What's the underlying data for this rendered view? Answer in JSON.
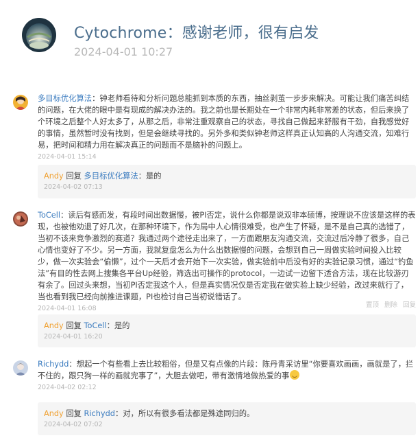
{
  "header": {
    "title": "Cytochrome：感谢老师，很有启发",
    "date": "2024-04-01 10:27"
  },
  "comments": [
    {
      "name": "多目标优化算法",
      "text": "钟老师看待和分析问题总能抓到本质的东西，抽丝剥茧一步步来解决。可能让我们痛苦纠结的问题，在大佬的眼中是有现成的解决办法的。我之前也是长期处在一个非常内耗非常差的状态，但后来换了个环境之后整个人好太多了，从那之后，非常注重观察自己的状态，寻找自己做起来舒服有干劲，自我感觉好的事情，虽然暂时没有找到，但是会继续寻找的。另外多和类似钟老师这样真正认知高的人沟通交流，知难行易，把时间和精力用在解决真正的问题而不是脑补的问题上。",
      "time": "2024-04-01 15:14",
      "reply": {
        "name": "Andy",
        "verb": "回复",
        "target": "多目标优化算法",
        "text": "是的",
        "time": "2024-04-02 07:13"
      }
    },
    {
      "name": "ToCell",
      "text": "读后有感而发，有段时间出数据慢，被PI否定，说什么你都是说双非本硕博，按理说不应该是这样的表现，也被他劝退了好几次，在那种环境下，作为局中人心情很难受，也产生了怀疑，是不是自己真的选错了，当初不该来竞争激烈的赛道？我通过两个途径走出来了，一方面跟朋友沟通交流，交流过后冷静了很多，自己心情也变好了不少。另一方面，我就复盘怎么为什么出数据慢的问题，会想到自己一周做实验时间投入比较少，做一次实验会“偷懒”，过个一天后才会开始下一次实验，做实验前中后没有好的实验记录习惯，通过“钓鱼法”有目的性去网上搜集各平台Up经验，筛选出可操作的protocol，一边试一边留下适合方法，现在比较游刃有余了。回过头来想，当初PI否定我这个人，但是真实情况仅是否定我在做实验上缺少经验，改过来就行了，当也看到我已经向前推进课题，PI也检讨自己当初说错话了。",
      "time": "2024-04-01 16:08",
      "actions": [
        "置顶",
        "删除",
        "回复"
      ],
      "reply": {
        "name": "Andy",
        "verb": "回复",
        "target": "ToCell",
        "text": "是的",
        "time": "2024-04-01 16:20"
      }
    },
    {
      "name": "Richydd",
      "text": "想起一个有些看上去比较粗俗，但是又有点像的片段：陈丹青采访里“你要喜欢画画，画就是了，拦不住的，跟只狗一样的画就完事了”，大胆去做吧，带有激情地做热爱的事",
      "time": "2024-04-02 02:12",
      "reply": {
        "name": "Andy",
        "verb": "回复",
        "target": "Richydd",
        "text": "对，所以有很多看法都是殊途同归的。",
        "time": "2024-04-02 07:02"
      }
    }
  ],
  "colors": {
    "title": "#4a6d8c",
    "commenter": "#3a7bbf",
    "reply_author": "#f0a030",
    "meta": "#b5b5b5",
    "reply_bg": "#f5f5f5"
  },
  "icons": {
    "header_avatar": "globe-avatar",
    "emoji": "grinning-face-icon"
  }
}
